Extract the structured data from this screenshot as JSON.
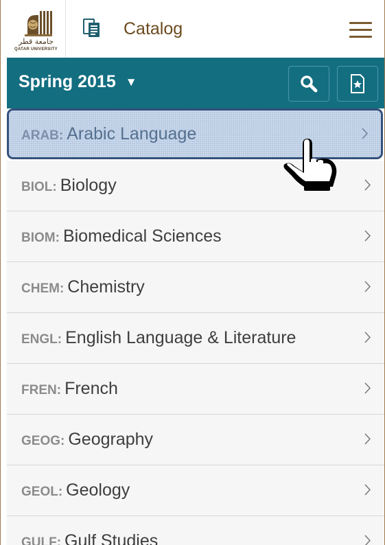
{
  "header": {
    "logo_arabic": "جامعة قطر",
    "logo_english": "QATAR UNIVERSITY",
    "catalog_icon": "catalog-icon",
    "title": "Catalog",
    "menu_icon": "hamburger-menu-icon"
  },
  "term_bar": {
    "term": "Spring 2015",
    "caret": "▼",
    "search_icon": "search-icon",
    "favorites_icon": "bookmark-star-icon"
  },
  "subjects": [
    {
      "code": "ARAB:",
      "name": "Arabic Language",
      "selected": true
    },
    {
      "code": "BIOL:",
      "name": "Biology"
    },
    {
      "code": "BIOM:",
      "name": "Biomedical Sciences"
    },
    {
      "code": "CHEM:",
      "name": "Chemistry"
    },
    {
      "code": "ENGL:",
      "name": "English Language & Literature"
    },
    {
      "code": "FREN:",
      "name": "French"
    },
    {
      "code": "GEOG:",
      "name": "Geography"
    },
    {
      "code": "GEOL:",
      "name": "Geology"
    },
    {
      "code": "GULF:",
      "name": "Gulf Studies"
    }
  ],
  "colors": {
    "term_bar": "#136e80",
    "title_brown": "#6b4a1e",
    "selected_row": "#b6c9e2",
    "selected_border": "#34507a"
  },
  "overlay": {
    "pointer_icon": "hand-pointer-icon"
  }
}
